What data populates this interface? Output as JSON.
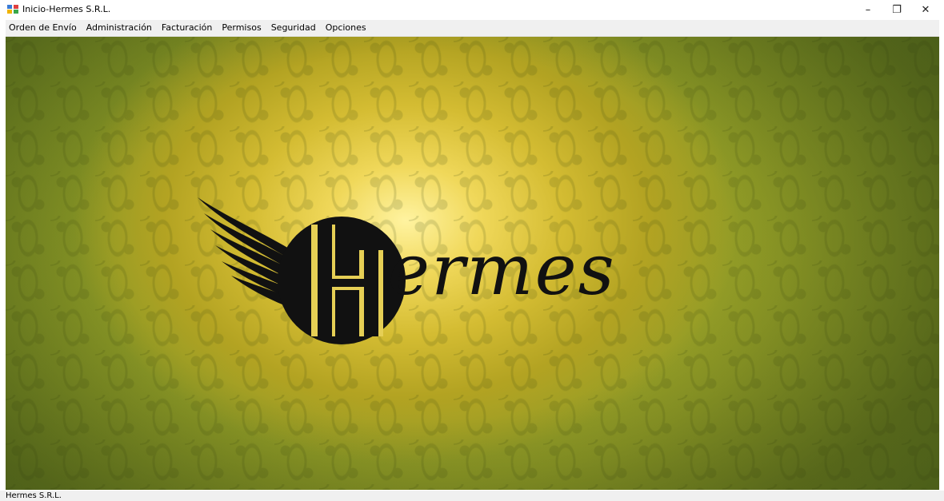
{
  "window": {
    "title": "Inicio-Hermes S.R.L.",
    "controls": {
      "minimize": "–",
      "restore": "❐",
      "close": "✕"
    }
  },
  "menubar": {
    "items": [
      {
        "label": "Orden de Envío"
      },
      {
        "label": "Administración"
      },
      {
        "label": "Facturación"
      },
      {
        "label": "Permisos"
      },
      {
        "label": "Seguridad"
      },
      {
        "label": "Opciones"
      }
    ]
  },
  "main": {
    "logo_text": "ermes",
    "logo_wordmark": "Hermes",
    "background_colors": {
      "highlight": "#fff3a0",
      "gold": "#d4bc32",
      "green": "#6d8322"
    },
    "logo_color": "#111111"
  },
  "statusbar": {
    "text": "Hermes S.R.L."
  },
  "icons": {
    "app": "app-icon",
    "logo": "hermes-wing-logo-icon"
  }
}
